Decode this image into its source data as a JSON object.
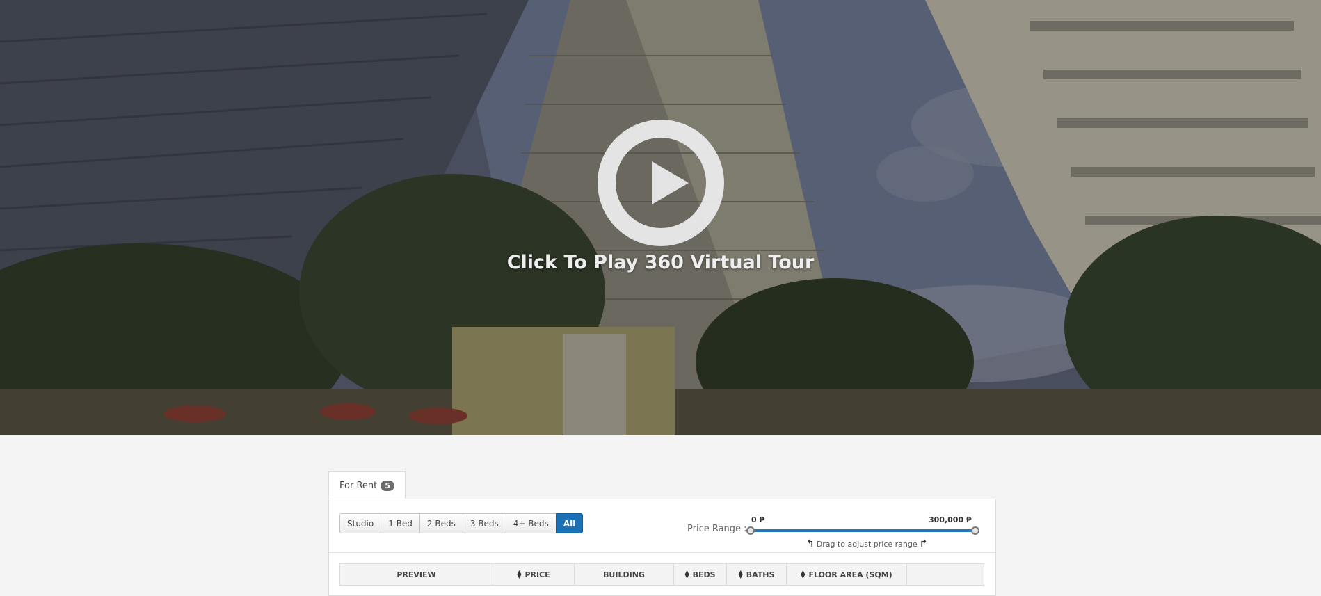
{
  "hero": {
    "caption": "Click To Play 360 Virtual Tour"
  },
  "listing": {
    "tab_label": "For Rent",
    "tab_count": "5",
    "bed_filters": [
      "Studio",
      "1 Bed",
      "2 Beds",
      "3 Beds",
      "4+ Beds",
      "All"
    ],
    "selected_filter": "All",
    "price": {
      "label": "Price Range :",
      "min": "0 ₱",
      "max": "300,000 ₱",
      "hint": "Drag to adjust price range",
      "range_selected": [
        0,
        300000
      ]
    },
    "columns": [
      "PREVIEW",
      "PRICE",
      "BUILDING",
      "BEDS",
      "BATHS",
      "FLOOR AREA (SQM)",
      ""
    ]
  },
  "colors": {
    "accent": "#1a6fb5",
    "badge": "#6b6b6b"
  }
}
